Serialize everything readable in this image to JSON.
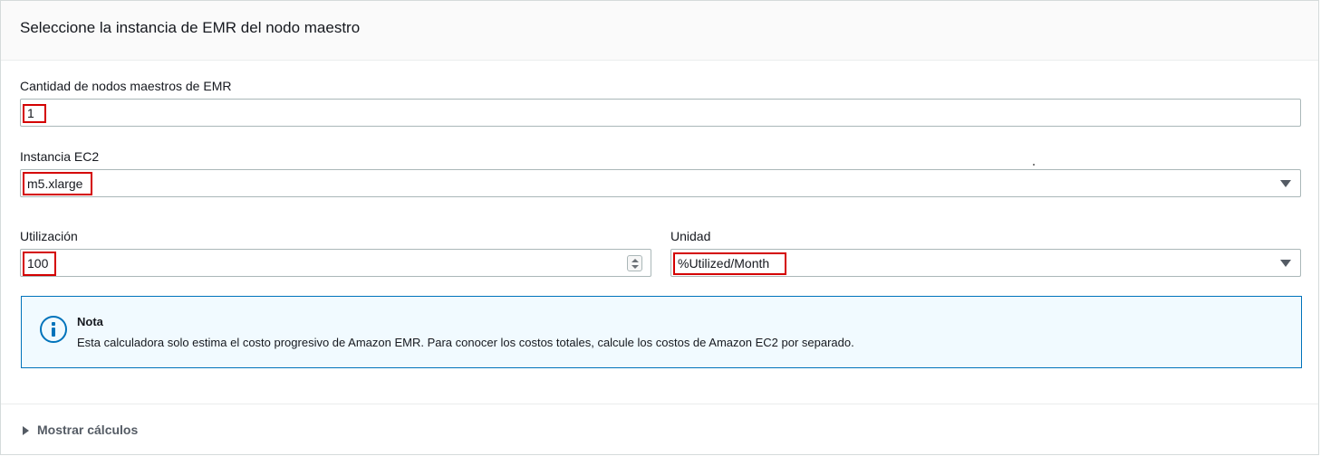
{
  "panel": {
    "title": "Seleccione la instancia de EMR del nodo maestro"
  },
  "fields": {
    "master_count": {
      "label": "Cantidad de nodos maestros de EMR",
      "value": "1"
    },
    "ec2_instance": {
      "label": "Instancia EC2",
      "value": "m5.xlarge"
    },
    "utilization": {
      "label": "Utilización",
      "value": "100"
    },
    "unit": {
      "label": "Unidad",
      "value": "%Utilized/Month"
    }
  },
  "alert": {
    "title": "Nota",
    "body": "Esta calculadora solo estima el costo progresivo de Amazon EMR. Para conocer los costos totales, calcule los costos de Amazon EC2 por separado.",
    "icon": "info-icon"
  },
  "footer": {
    "expander_label": "Mostrar cálculos"
  },
  "colors": {
    "highlight": "#d40000",
    "info_accent": "#0073bb",
    "info_bg": "#f1faff"
  }
}
